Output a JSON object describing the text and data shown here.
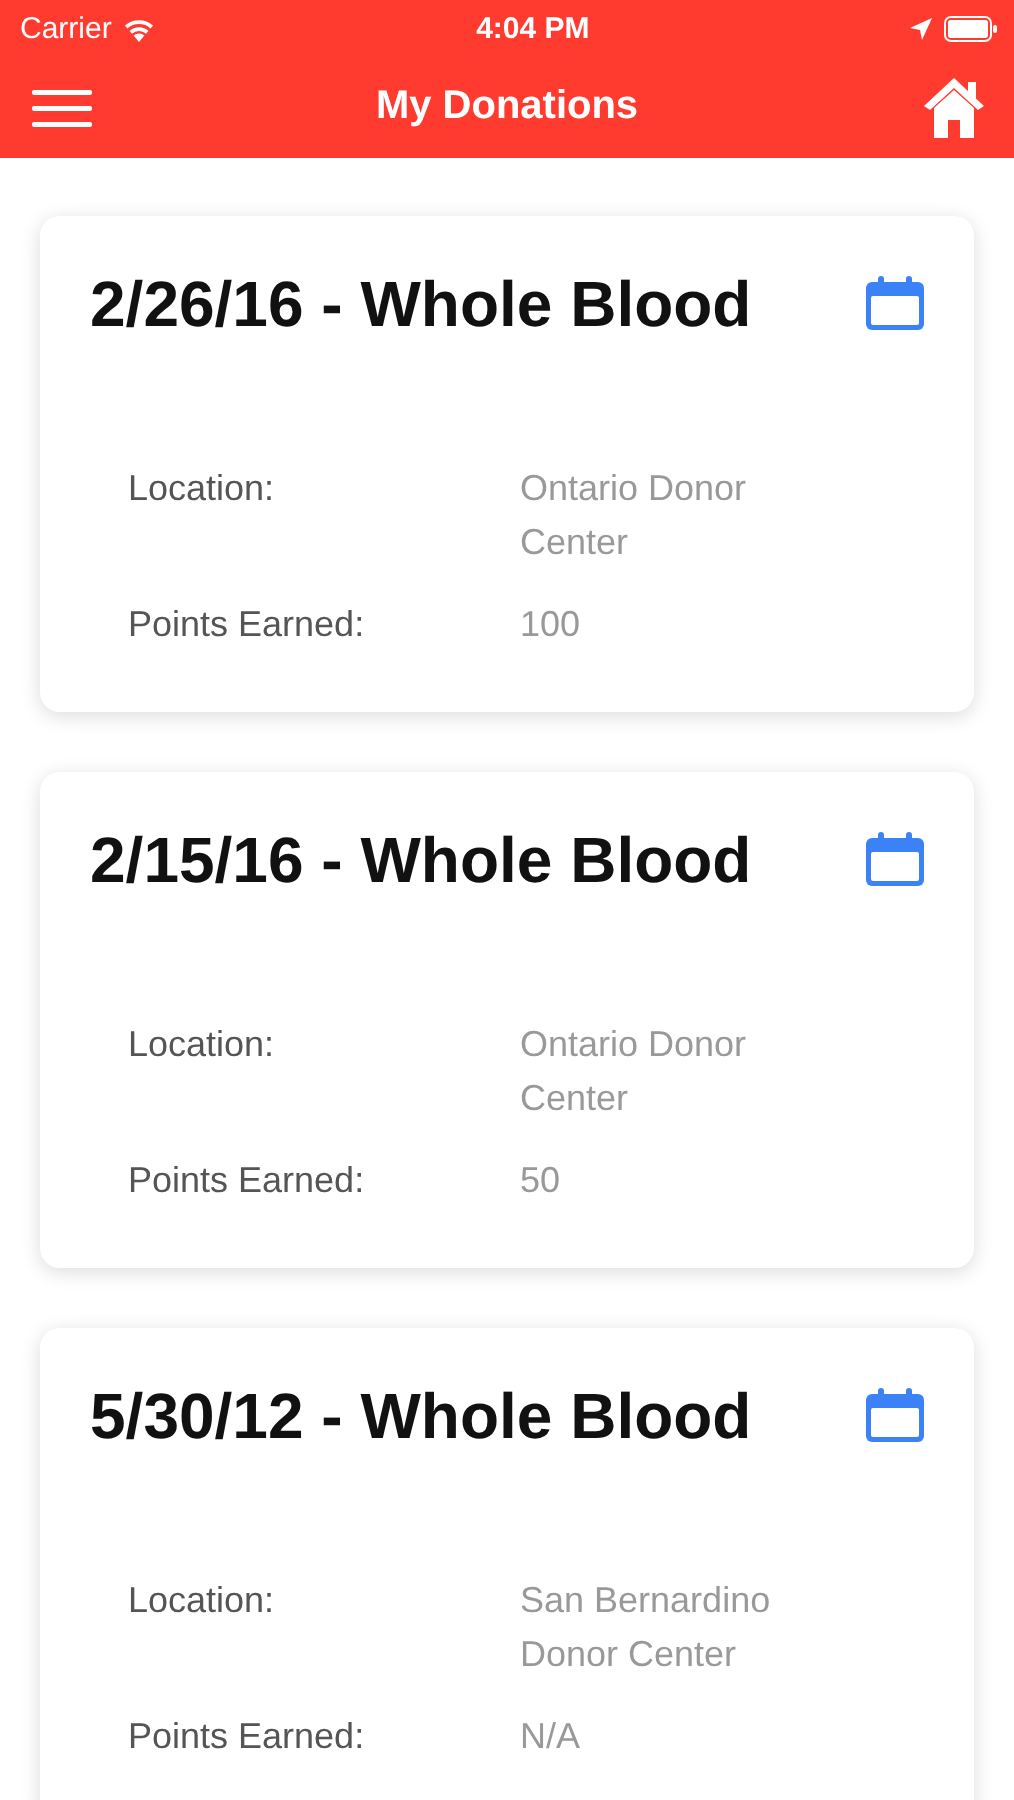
{
  "status_bar": {
    "carrier": "Carrier",
    "time": "4:04 PM"
  },
  "nav": {
    "title": "My Donations"
  },
  "donations": [
    {
      "title": "2/26/16 - Whole Blood",
      "fields": [
        {
          "label": "Location:",
          "value": "Ontario Donor Center"
        },
        {
          "label": "Points Earned:",
          "value": "100"
        }
      ]
    },
    {
      "title": "2/15/16 - Whole Blood",
      "fields": [
        {
          "label": "Location:",
          "value": "Ontario Donor Center"
        },
        {
          "label": "Points Earned:",
          "value": "50"
        }
      ]
    },
    {
      "title": "5/30/12 - Whole Blood",
      "fields": [
        {
          "label": "Location:",
          "value": "San Bernardino Donor Center"
        },
        {
          "label": "Points Earned:",
          "value": "N/A"
        }
      ]
    }
  ]
}
